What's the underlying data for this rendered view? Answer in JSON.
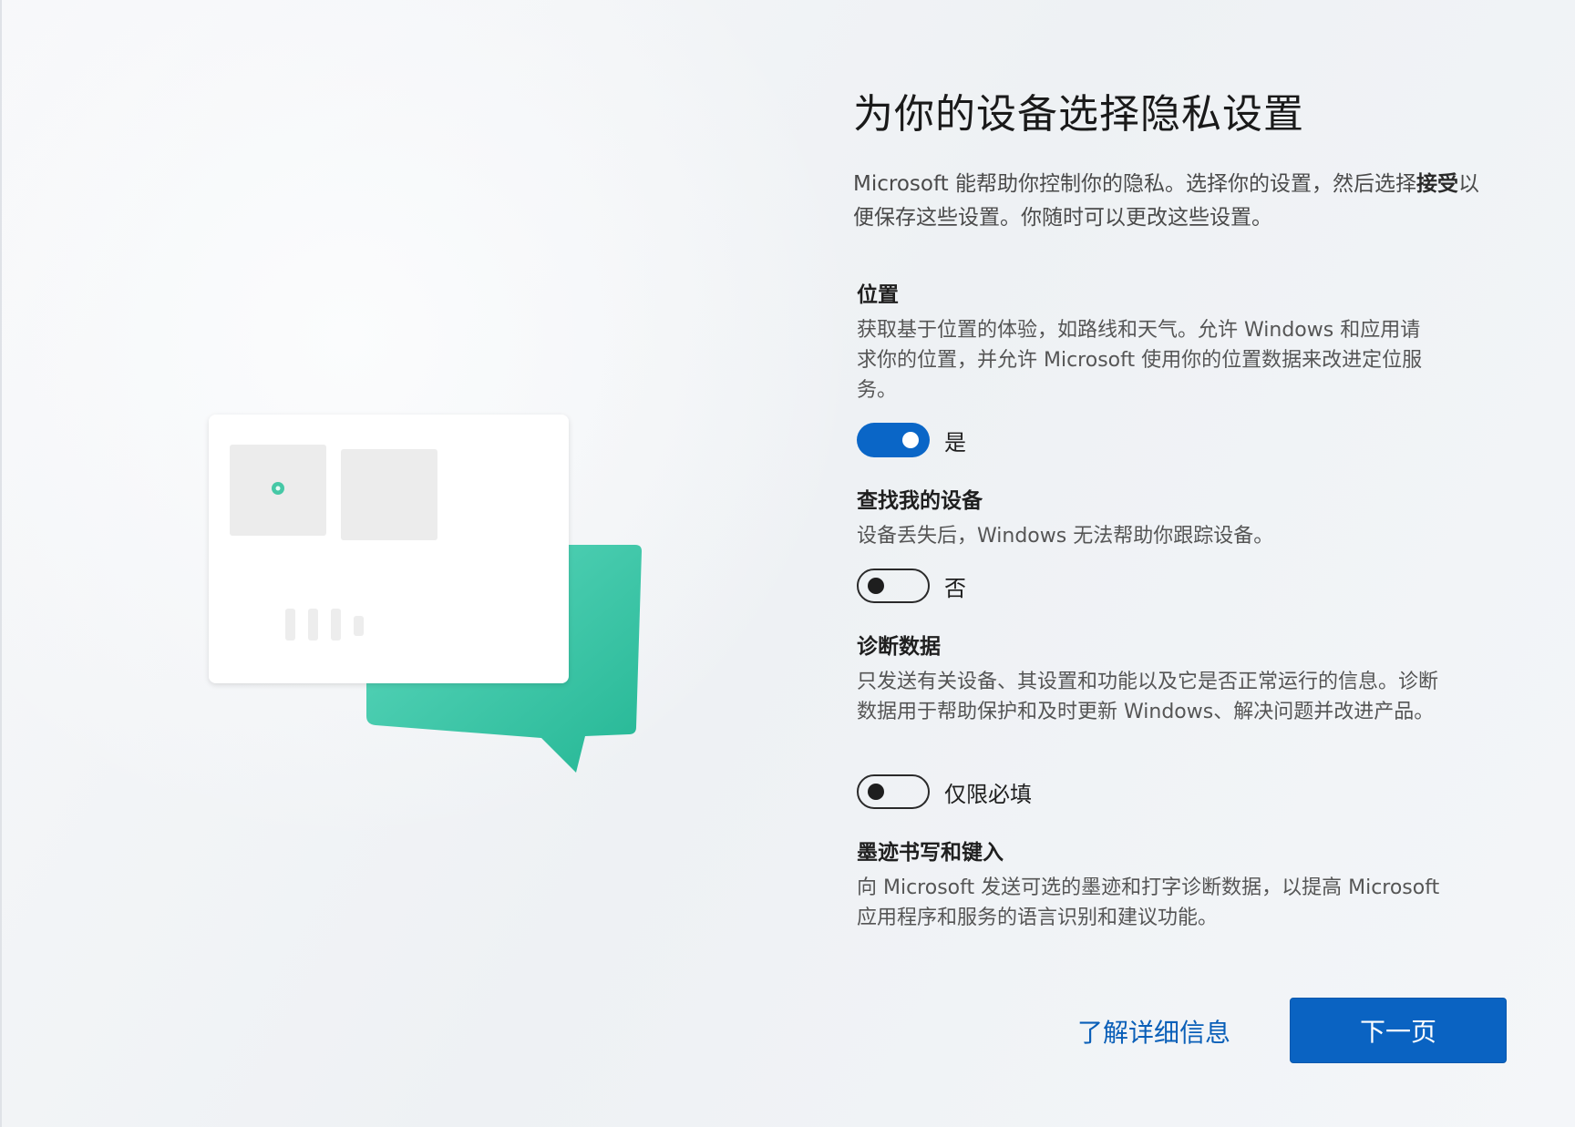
{
  "page": {
    "title": "为你的设备选择隐私设置",
    "intro_prefix": "Microsoft 能帮助你控制你的隐私。选择你的设置，然后选择",
    "intro_bold": "接受",
    "intro_suffix": "以便保存这些设置。你随时可以更改这些设置。"
  },
  "settings": [
    {
      "title": "位置",
      "description": "获取基于位置的体验，如路线和天气。允许 Windows 和应用请求你的位置，并允许 Microsoft 使用你的位置数据来改进定位服务。",
      "toggle_state": "on",
      "toggle_label": "是"
    },
    {
      "title": "查找我的设备",
      "description": "设备丢失后，Windows 无法帮助你跟踪设备。",
      "toggle_state": "off",
      "toggle_label": "否"
    },
    {
      "title": "诊断数据",
      "description": "只发送有关设备、其设置和功能以及它是否正常运行的信息。诊断数据用于帮助保护和及时更新 Windows、解决问题并改进产品。",
      "toggle_state": "off",
      "toggle_label": "仅限必填"
    },
    {
      "title": "墨迹书写和键入",
      "description": "向 Microsoft 发送可选的墨迹和打字诊断数据，以提高 Microsoft 应用程序和服务的语言识别和建议功能。"
    }
  ],
  "footer": {
    "learn_more": "了解详细信息",
    "next": "下一页"
  },
  "colors": {
    "accent": "#0a63c2",
    "illustration_teal": "#3ec9a7"
  }
}
